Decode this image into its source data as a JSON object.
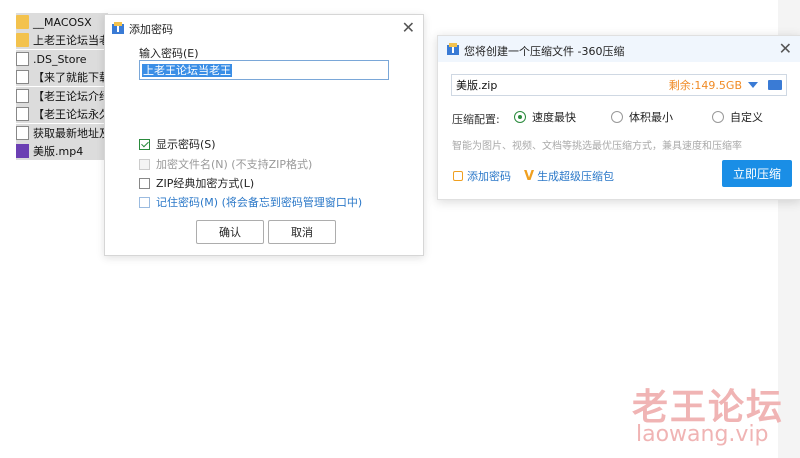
{
  "explorer": {
    "files": [
      {
        "name": "__MACOSX",
        "icon": "folder-icon"
      },
      {
        "name": "上老王论坛当老",
        "icon": "folder-icon"
      },
      {
        "name": ".DS_Store",
        "icon": "file-icon"
      },
      {
        "name": "【来了就能下载",
        "icon": "file-icon"
      },
      {
        "name": "【老王论坛介绍",
        "icon": "file-icon"
      },
      {
        "name": "【老王论坛永久",
        "icon": "file-icon"
      },
      {
        "name": "获取最新地址及",
        "icon": "file-icon"
      },
      {
        "name": "美版.mp4",
        "icon": "video-icon"
      }
    ]
  },
  "password_dialog": {
    "title": "添加密码",
    "input_label": "输入密码(E)",
    "input_value": "上老王论坛当老王",
    "show_password": "显示密码(S)",
    "encrypt_filenames": "加密文件名(N) (不支持ZIP格式)",
    "zip_classic": "ZIP经典加密方式(L)",
    "remember_password": "记住密码(M) (将会备忘到密码管理窗口中)",
    "ok": "确认",
    "cancel": "取消"
  },
  "compress_dialog": {
    "title": "您将创建一个压缩文件 -360压缩",
    "filename": "美版.zip",
    "free_space": "剩余:149.5GB",
    "config_label": "压缩配置:",
    "options": [
      "速度最快",
      "体积最小",
      "自定义"
    ],
    "selected_option": "速度最快",
    "hint": "智能为图片、视频、文档等挑选最优压缩方式，兼具速度和压缩率",
    "add_password": "添加密码",
    "super_pack": "生成超级压缩包",
    "compress_now": "立即压缩"
  },
  "watermark": {
    "text": "老王论坛",
    "url": "laowang.vip"
  },
  "colors": {
    "accent": "#1a8ee6",
    "link": "#2b78c8",
    "free_space": "#f08a24",
    "watermark": "#f0b4b4"
  }
}
